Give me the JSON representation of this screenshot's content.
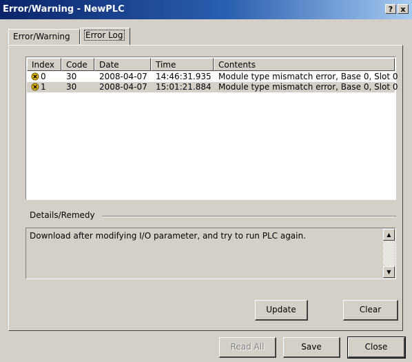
{
  "window": {
    "title": "Error/Warning - NewPLC",
    "help_glyph": "?",
    "close_glyph": "x"
  },
  "tabs": [
    {
      "label": "Error/Warning",
      "active": false
    },
    {
      "label": "Error Log",
      "active": true
    }
  ],
  "error_log": {
    "columns": [
      "Index",
      "Code",
      "Date",
      "Time",
      "Contents"
    ],
    "rows": [
      {
        "icon": "warning-icon",
        "index": "0",
        "code": "30",
        "date": "2008-04-07",
        "time": "14:46:31.935",
        "contents": "Module type mismatch error, Base 0, Slot 0",
        "selected": false
      },
      {
        "icon": "warning-icon",
        "index": "1",
        "code": "30",
        "date": "2008-04-07",
        "time": "15:01:21.884",
        "contents": "Module type mismatch error, Base 0, Slot 0",
        "selected": true
      }
    ]
  },
  "details": {
    "label": "Details/Remedy",
    "text": "Download after modifying I/O parameter, and try to run PLC again."
  },
  "buttons": {
    "update": "Update",
    "clear": "Clear",
    "read_all": "Read All",
    "save": "Save",
    "close": "Close"
  },
  "colors": {
    "titlebar_start": "#0a246a",
    "titlebar_end": "#a6caf0",
    "dialog_bg": "#d4d0c8",
    "warning_icon": "#e5b800"
  }
}
